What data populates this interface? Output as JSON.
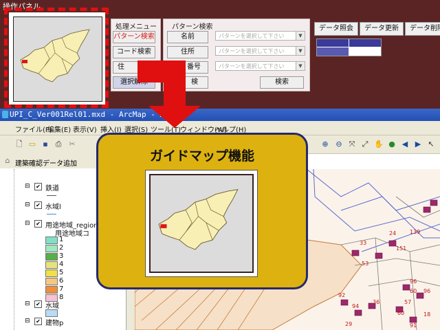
{
  "panel": {
    "title": "操作パネル",
    "process_menu": {
      "title": "処理メニュー",
      "buttons": [
        "パターン検索",
        "コード検索",
        "住",
        "選択解除"
      ]
    },
    "pattern_search": {
      "title": "パターン検索",
      "buttons": [
        "名前",
        "住所",
        "番号",
        "検"
      ],
      "placeholder": "パターンを選択して下さい",
      "search_label": "検索"
    },
    "data_buttons": [
      "データ照会",
      "データ更新",
      "データ削除"
    ]
  },
  "arcmap": {
    "title": "UPI_C_Ver001Rel01.mxd - ArcMap - ArcV",
    "menus": [
      "ファイル(F)",
      "編集(E)",
      "表示(V)",
      "挿入(I)",
      "選択(S)",
      "ツール(T)",
      "ウィンドウ(W)",
      "ヘルプ(H)"
    ],
    "add_data_button": "建築確認データ追加",
    "toc": {
      "layers": [
        {
          "label": "鉄道",
          "checked": true
        },
        {
          "label": "水域l",
          "checked": true
        },
        {
          "label": "用途地域_region",
          "checked": true,
          "sublabel": "用途地域コ"
        },
        {
          "label": "水域",
          "checked": true
        },
        {
          "label": "建物p",
          "checked": true
        }
      ],
      "legend": [
        {
          "label": "1",
          "color": "#7fe0c8"
        },
        {
          "label": "2",
          "color": "#9fe8c0"
        },
        {
          "label": "3",
          "color": "#56b04a"
        },
        {
          "label": "4",
          "color": "#e8e27a"
        },
        {
          "label": "5",
          "color": "#f0e04a"
        },
        {
          "label": "6",
          "color": "#f4c880"
        },
        {
          "label": "7",
          "color": "#f08e3a"
        },
        {
          "label": "8",
          "color": "#f7c1d8"
        }
      ]
    },
    "map_labels": [
      "139",
      "33",
      "24",
      "151",
      "96",
      "60",
      "96",
      "53",
      "92",
      "94",
      "36",
      "57",
      "91",
      "60",
      "18",
      "29"
    ]
  },
  "guide": {
    "title": "ガイドマップ機能"
  },
  "colors": {
    "panel_bg": "#5b2424",
    "highlight_red": "#e01010",
    "guide_bg": "#ddb210",
    "guide_border": "#262a6a",
    "map_fill": "#f7efb4",
    "arrow": "#e01010"
  },
  "icons": [
    "new-icon",
    "open-icon",
    "save-icon",
    "print-icon",
    "zoom-in-icon",
    "zoom-out-icon",
    "pan-icon",
    "globe-icon",
    "back-icon",
    "forward-icon",
    "select-icon"
  ]
}
